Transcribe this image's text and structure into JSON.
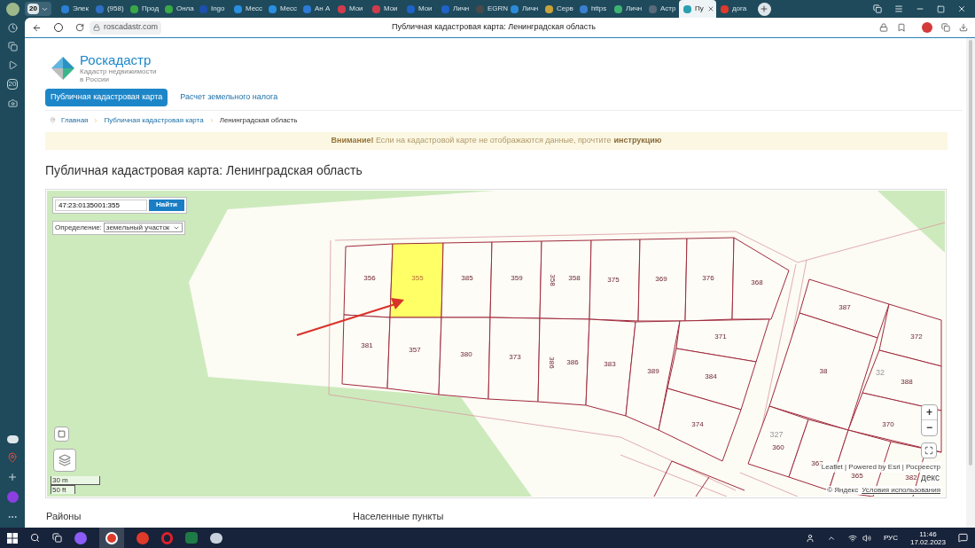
{
  "browser": {
    "tab_group_count": "20",
    "tabs": [
      {
        "title": "Элек",
        "color": "#2a7fd4",
        "selected": false
      },
      {
        "title": "(958)",
        "color": "#2f6fc4",
        "selected": false
      },
      {
        "title": "Прод",
        "color": "#3aa845",
        "selected": false
      },
      {
        "title": "Онла",
        "color": "#3aa845",
        "selected": false
      },
      {
        "title": "Ingo",
        "color": "#1d4fb0",
        "selected": false
      },
      {
        "title": "Месс",
        "color": "#2a8fe0",
        "selected": false
      },
      {
        "title": "Месс",
        "color": "#2a8fe0",
        "selected": false
      },
      {
        "title": "Ан А",
        "color": "#2d7bd8",
        "selected": false
      },
      {
        "title": "Мои",
        "color": "#d23b4c",
        "selected": false
      },
      {
        "title": "Мои",
        "color": "#d23b4c",
        "selected": false
      },
      {
        "title": "Мои",
        "color": "#1e63c8",
        "selected": false
      },
      {
        "title": "Личн",
        "color": "#1e63c8",
        "selected": false
      },
      {
        "title": "EGRN",
        "color": "#4a4a4a",
        "selected": false
      },
      {
        "title": "Личн",
        "color": "#2d8ad8",
        "selected": false
      },
      {
        "title": "Серв",
        "color": "#c9a23a",
        "selected": false
      },
      {
        "title": "https",
        "color": "#3a7fd0",
        "selected": false
      },
      {
        "title": "Личн",
        "color": "#3cb371",
        "selected": false
      },
      {
        "title": "Астр",
        "color": "#5a6a7a",
        "selected": false
      },
      {
        "title": "Пу",
        "color": "#2a9fb0",
        "selected": true
      },
      {
        "title": "дога",
        "color": "#e0392b",
        "selected": false
      }
    ],
    "address": "roscadastr.com",
    "page_title": "Публичная кадастровая карта: Ленинградская область",
    "sidebar_badge": "20"
  },
  "site": {
    "logo_name": "Роскадастр",
    "logo_tagline": [
      "Кадастр недвижимости",
      "в России"
    ],
    "nav": [
      {
        "label": "Публичная кадастровая карта",
        "selected": true
      },
      {
        "label": "Расчет земельного налога",
        "selected": false
      }
    ],
    "breadcrumb": [
      "Главная",
      "Публичная кадастровая карта",
      "Ленинградская область"
    ],
    "notice": {
      "text": "**Внимание!** Если на кадастровой карте не отображаются данные, прочтите",
      "link": "инструкцию"
    },
    "heading": "Публичная кадастровая карта: Ленинградская область"
  },
  "map": {
    "search": {
      "value": "47:23:0135001:355",
      "button": "Найти"
    },
    "definition": {
      "label": "Определение:",
      "value": "земельный участок"
    },
    "parcels": [
      {
        "label": "356",
        "selected": false
      },
      {
        "label": "355",
        "selected": true
      },
      {
        "label": "385",
        "selected": false
      },
      {
        "label": "359",
        "selected": false
      },
      {
        "label": "358",
        "selected": false
      },
      {
        "label": "375",
        "selected": false
      },
      {
        "label": "369",
        "selected": false
      },
      {
        "label": "376",
        "selected": false
      },
      {
        "label": "368",
        "selected": false
      },
      {
        "label": "381",
        "selected": false
      },
      {
        "label": "357",
        "selected": false
      },
      {
        "label": "380",
        "selected": false
      },
      {
        "label": "373",
        "selected": false
      },
      {
        "label": "386",
        "selected": false
      },
      {
        "label": "383",
        "selected": false
      },
      {
        "label": "389",
        "selected": false
      },
      {
        "label": "371",
        "selected": false
      },
      {
        "label": "384",
        "selected": false
      },
      {
        "label": "374",
        "selected": false
      },
      {
        "label": "387",
        "selected": false
      },
      {
        "label": "38",
        "selected": false
      },
      {
        "label": "372",
        "selected": false
      },
      {
        "label": "388",
        "selected": false
      },
      {
        "label": "370",
        "selected": false
      },
      {
        "label": "360",
        "selected": false
      },
      {
        "label": "367",
        "selected": false
      },
      {
        "label": "365",
        "selected": false
      }
    ],
    "extra_labels": [
      {
        "label": "358",
        "kind": "rotated"
      },
      {
        "label": "386",
        "kind": "rotated"
      },
      {
        "label": "327",
        "kind": "faint"
      },
      {
        "label": "32",
        "kind": "faint"
      },
      {
        "label": "382",
        "kind": "plain"
      }
    ],
    "zoom_in": "+",
    "zoom_out": "−",
    "scale": [
      "30 m",
      "50 ft"
    ],
    "attribution": "Leaflet | Powered by Esri | Росреестр",
    "provider_logo": "декс",
    "copyright": "© Яндекс",
    "terms": "Условия использования"
  },
  "sections": [
    "Районы",
    "Населенные пункты"
  ],
  "taskbar": {
    "language": "РУС",
    "time": "11:46",
    "date": "17.02.2023"
  }
}
